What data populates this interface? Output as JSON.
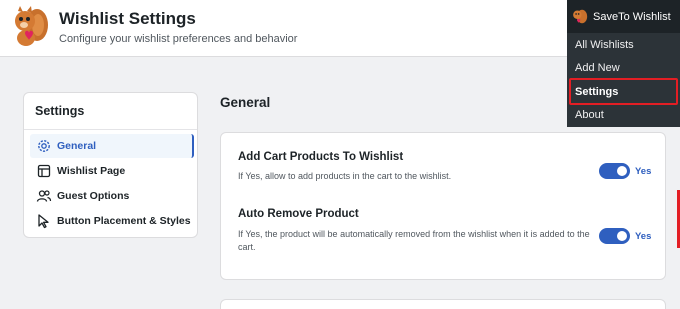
{
  "header": {
    "title": "Wishlist Settings",
    "subtitle": "Configure your wishlist preferences and behavior",
    "logo_icon": "squirrel-heart-logo"
  },
  "sidebar": {
    "title": "Settings",
    "items": [
      {
        "label": "General",
        "icon": "gear-icon",
        "active": true
      },
      {
        "label": "Wishlist Page",
        "icon": "layout-icon",
        "active": false
      },
      {
        "label": "Guest Options",
        "icon": "users-icon",
        "active": false
      },
      {
        "label": "Button Placement & Styles",
        "icon": "cursor-icon",
        "active": false
      }
    ]
  },
  "main": {
    "section_title": "General",
    "options": [
      {
        "title": "Add Cart Products To Wishlist",
        "description": "If Yes, allow to add products in the cart to the wishlist.",
        "toggle_label": "Yes",
        "enabled": true
      },
      {
        "title": "Auto Remove Product",
        "description": "If Yes, the product will be automatically removed from the wishlist when it is added to the cart.",
        "toggle_label": "Yes",
        "enabled": true
      }
    ]
  },
  "admin_menu": {
    "title": "SaveTo Wishlist",
    "items": [
      "All Wishlists",
      "Add New",
      "Settings",
      "About"
    ],
    "current": "Settings"
  },
  "colors": {
    "accent": "#2f5fbf",
    "menu_bg": "#2c3338",
    "menu_top_bg": "#1d2327",
    "highlight": "#e31e24"
  }
}
